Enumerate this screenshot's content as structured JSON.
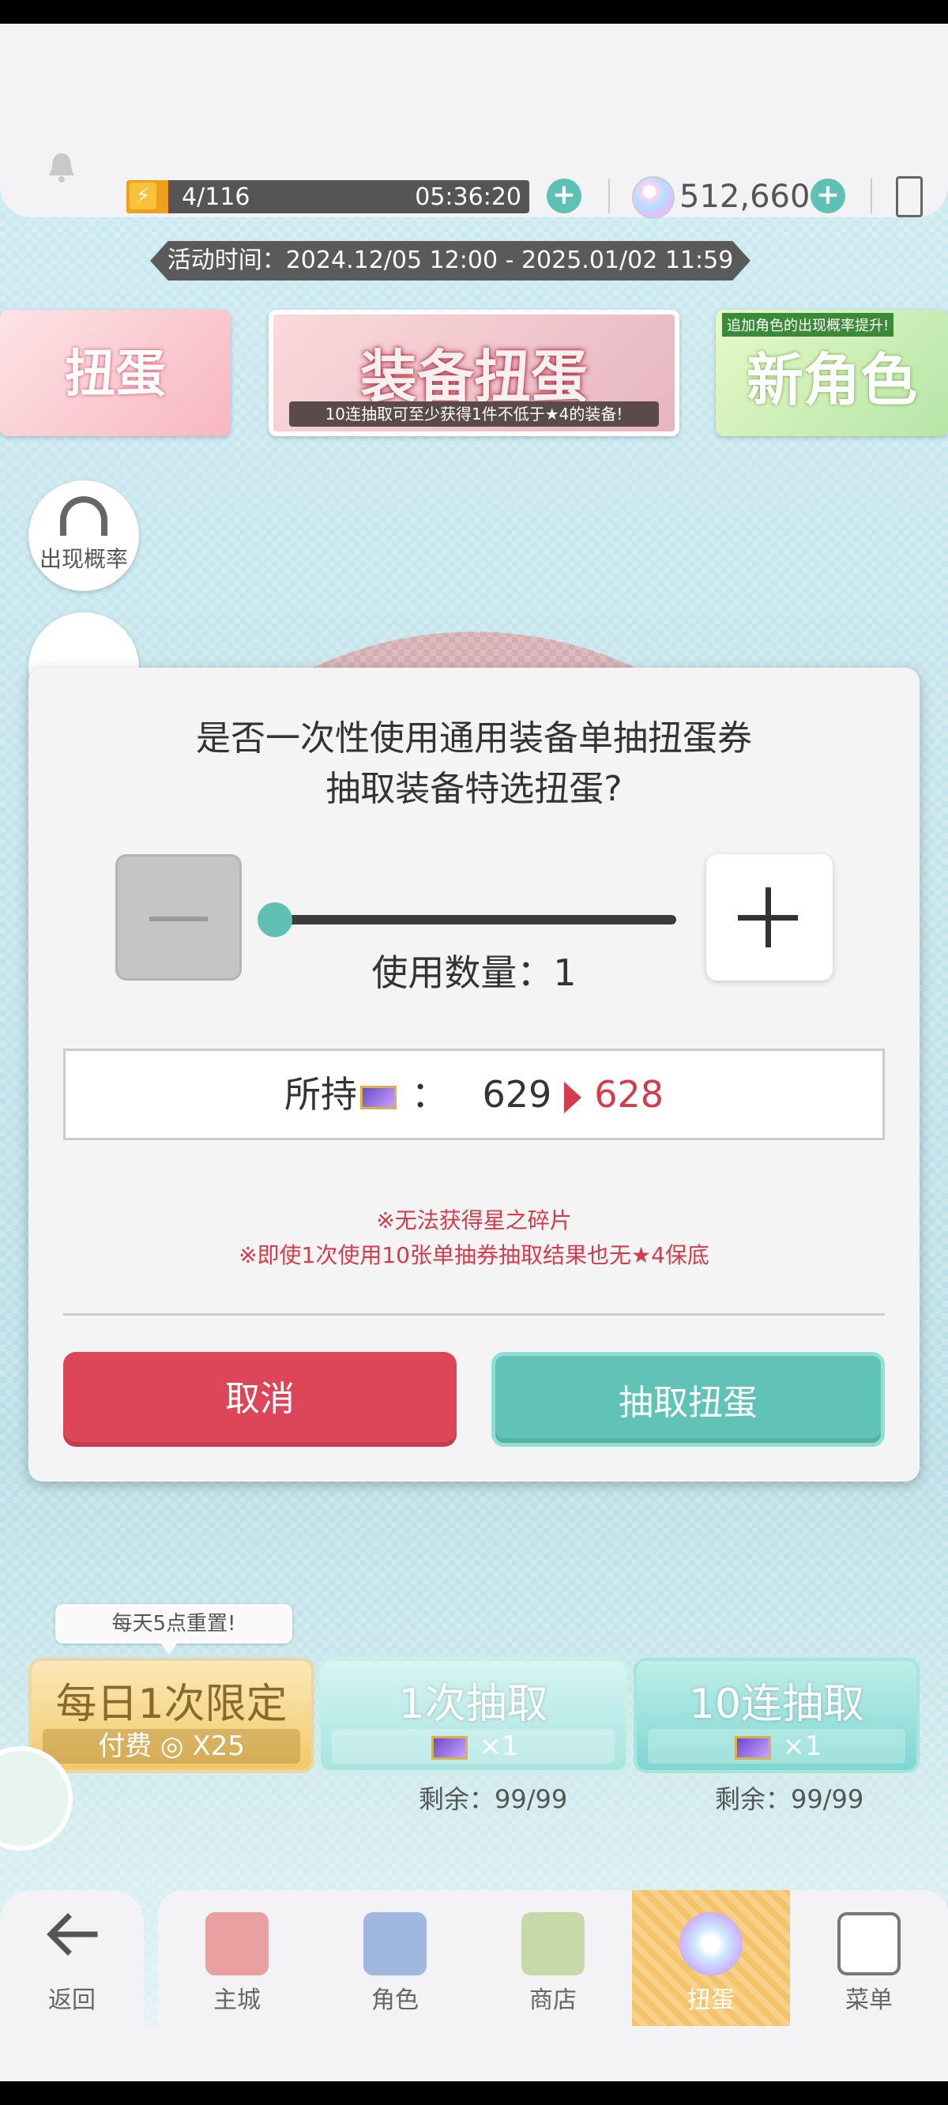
{
  "status": {
    "stamina": "4/116",
    "stamina_fraction": 0.034,
    "timer": "05:36:20",
    "currency": "512,660"
  },
  "event_time": "活动时间：2024.12/05 12:00 - 2025.01/02 11:59",
  "banners": {
    "left": {
      "title": "扭蛋"
    },
    "center": {
      "title": "装备扭蛋",
      "subtitle": "10连抽取可至少获得1件不低于★4的装备!"
    },
    "right": {
      "tag": "追加角色的出现概率提升!",
      "title": "新角色"
    }
  },
  "side": {
    "probability": "出现概率"
  },
  "modal": {
    "question_line1": "是否一次性使用通用装备单抽扭蛋券",
    "question_line2": "抽取装备特选扭蛋?",
    "quantity_label": "使用数量：1",
    "owned_label": "所持",
    "owned_sep": "：",
    "owned_current": "629",
    "owned_after": "628",
    "note1": "※无法获得星之碎片",
    "note2": "※即使1次使用10张单抽券抽取结果也无★4保底",
    "cancel": "取消",
    "confirm": "抽取扭蛋"
  },
  "gacha": {
    "tip": "每天5点重置!",
    "daily": {
      "title": "每日1次限定",
      "cost": "付费 ◎ X25"
    },
    "single": {
      "title": "1次抽取",
      "cost": "×1",
      "remain": "剩余：99/99"
    },
    "ten": {
      "title": "10连抽取",
      "cost": "×1",
      "remain": "剩余：99/99"
    }
  },
  "nav": {
    "back": "返回",
    "items": [
      "主城",
      "角色",
      "商店",
      "扭蛋",
      "菜单"
    ],
    "active": "扭蛋"
  },
  "colors": {
    "accent": "#5fc0b4",
    "danger": "#dd4658",
    "stamina": "#f0a020"
  }
}
